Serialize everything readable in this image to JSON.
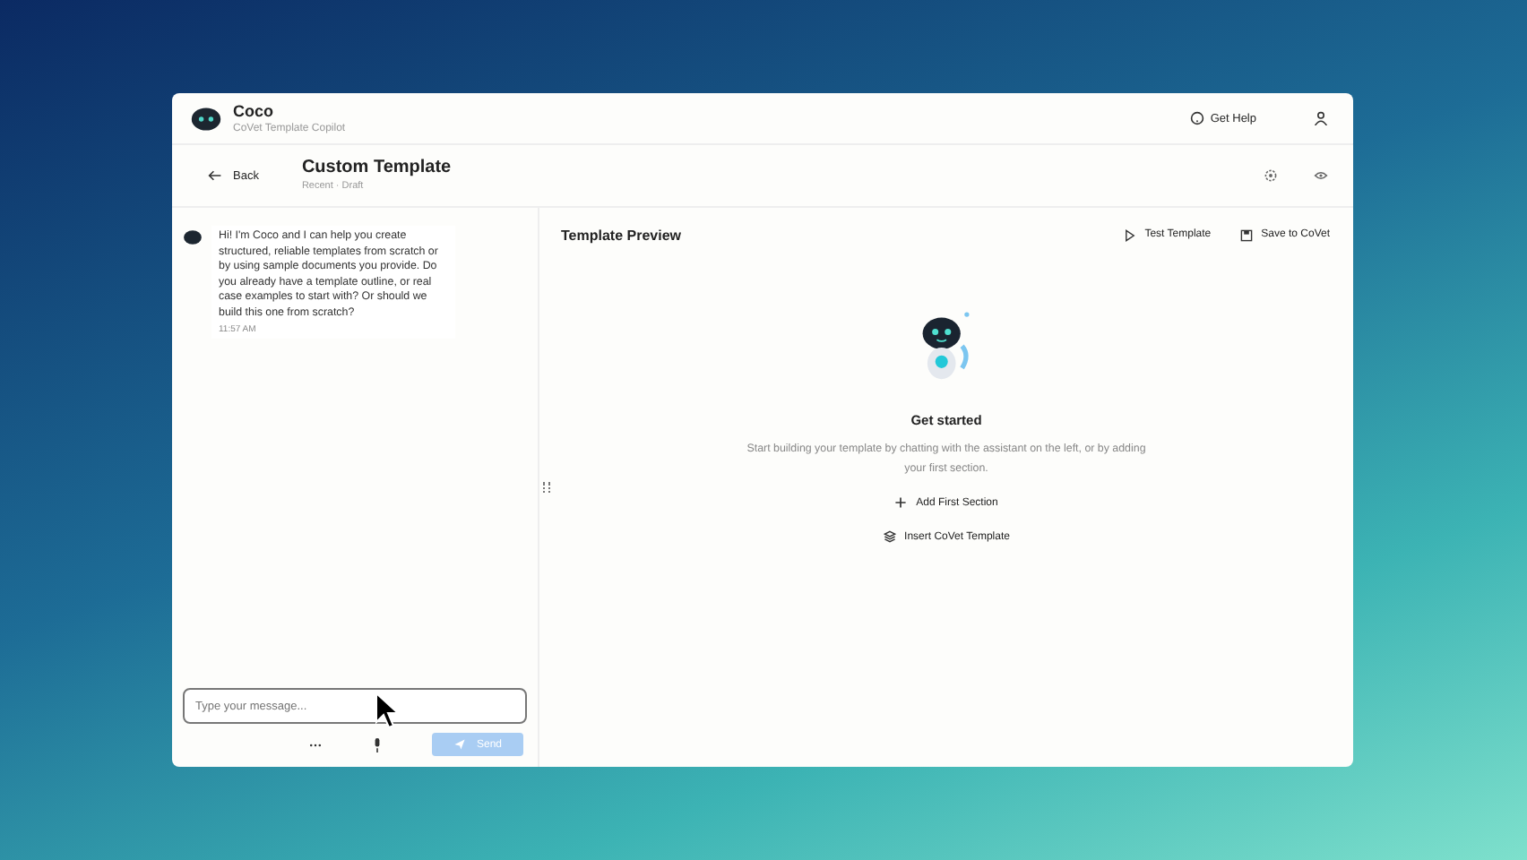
{
  "app": {
    "name": "Coco",
    "subtitle": "CoVet Template Copilot",
    "help": "Get Help"
  },
  "header": {
    "back": "Back",
    "title": "Custom Template",
    "meta": "Recent · Draft"
  },
  "chat": {
    "messages": [
      {
        "text": "Hi! I'm Coco and I can help you create structured, reliable templates from scratch or by using sample documents you provide. Do you already have a template outline, or real case examples to start with? Or should we build this one from scratch?",
        "time": "11:57 AM"
      }
    ],
    "input": {
      "placeholder": "Type your message..."
    },
    "send": {
      "label": "Send",
      "disabled": true
    }
  },
  "preview": {
    "title": "Template Preview",
    "actions": [
      {
        "kind": "play",
        "label": "Test Template"
      },
      {
        "kind": "save",
        "label": "Save to CoVet"
      }
    ],
    "empty": {
      "title": "Get started",
      "text": "Start building your template by chatting with the assistant on the left, or by adding your first section.",
      "buttons": [
        {
          "kind": "add",
          "label": "Add First Section"
        },
        {
          "kind": "insert",
          "label": "Insert CoVet Template"
        }
      ]
    }
  }
}
